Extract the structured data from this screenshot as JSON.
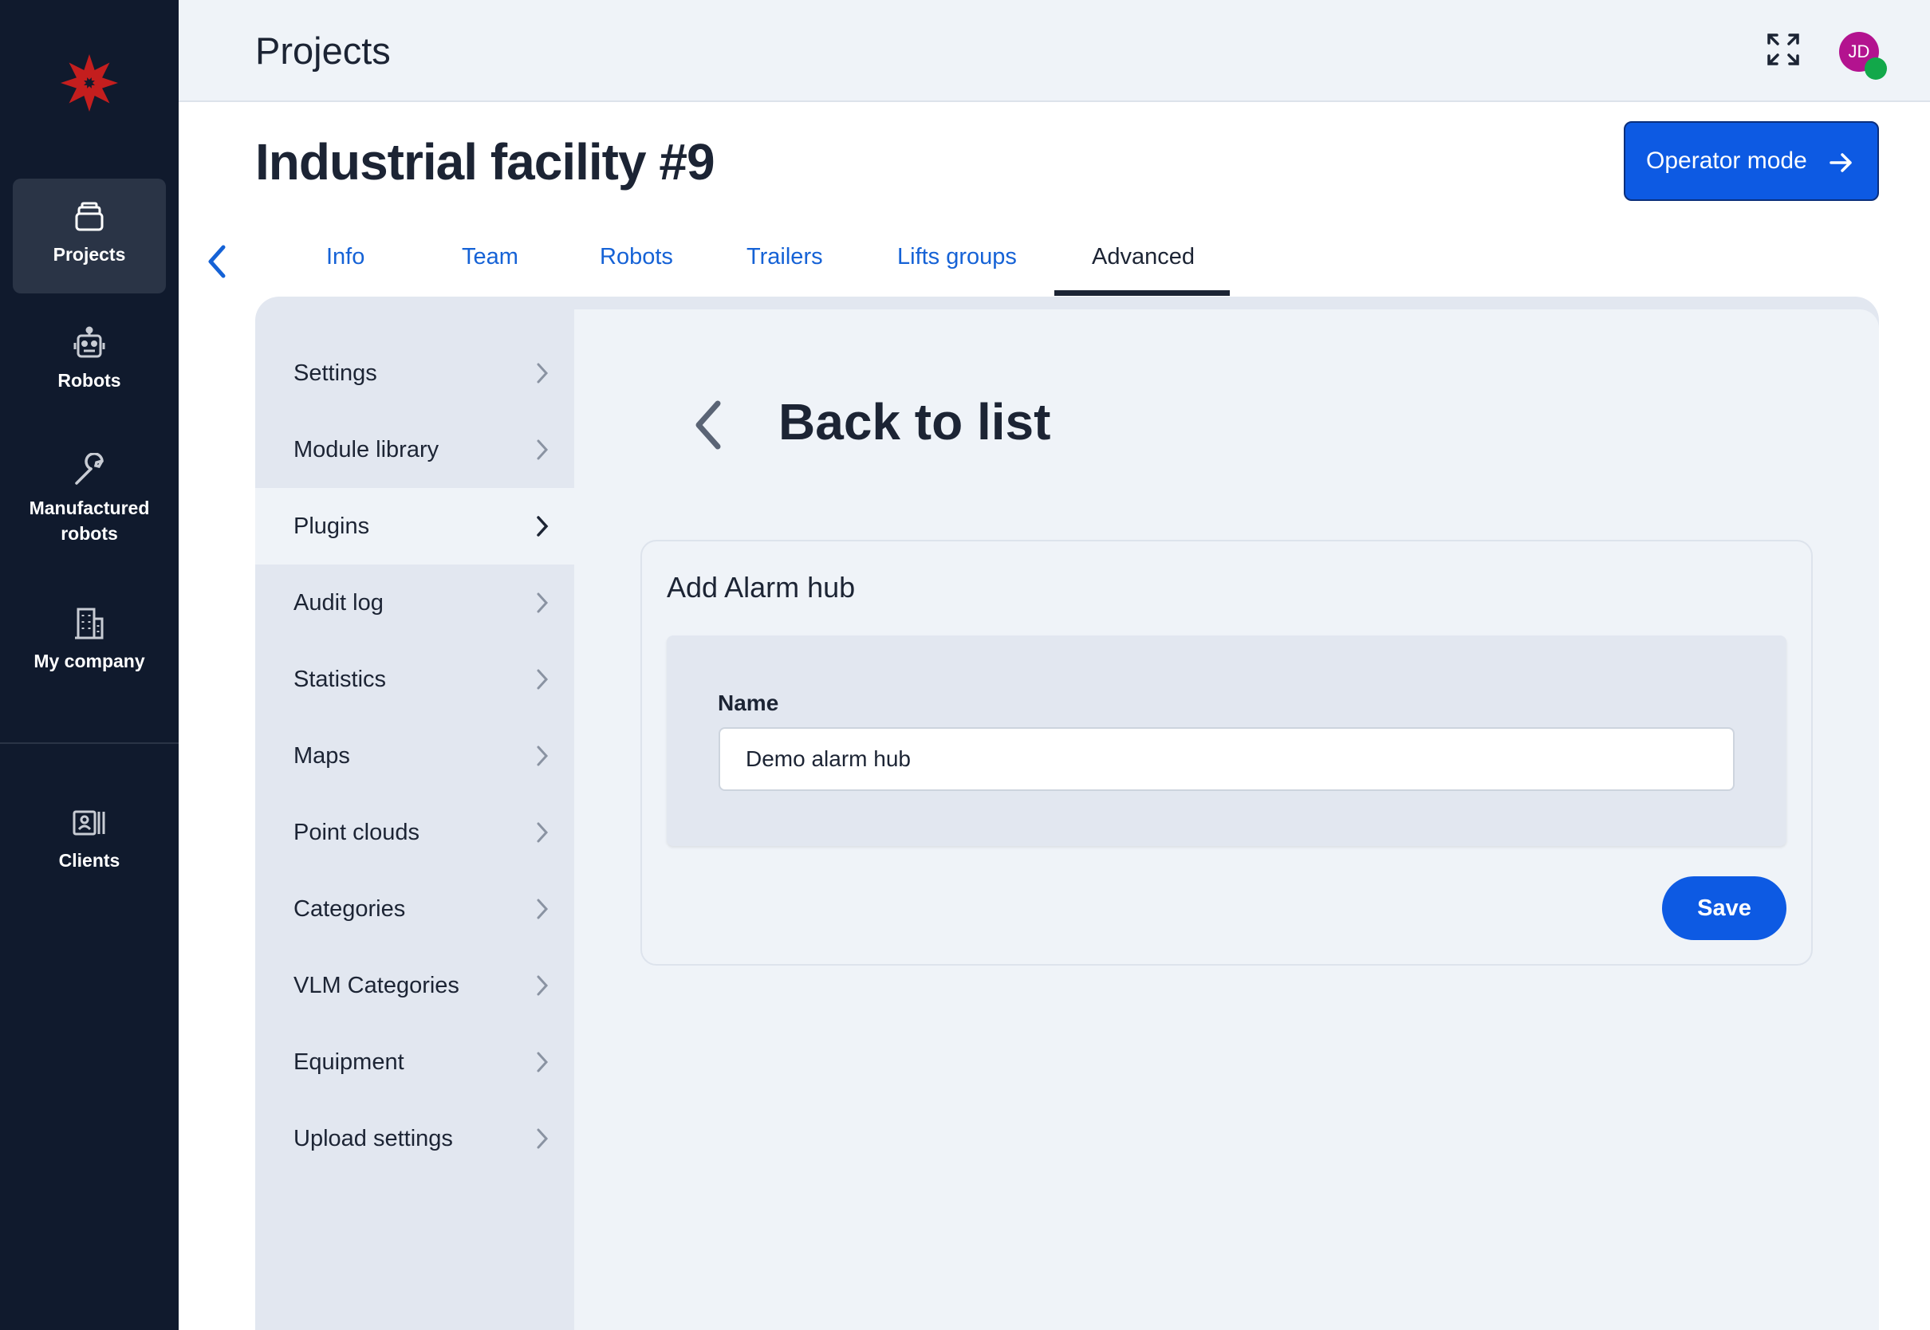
{
  "app": {
    "brand_icon": "snowflake-star-logo",
    "accent_color": "#0d5ae3",
    "nav_bg": "#101a2d"
  },
  "nav": {
    "items": [
      {
        "label": "Projects",
        "icon": "stack-icon",
        "active": true
      },
      {
        "label": "Robots",
        "icon": "robot-icon"
      },
      {
        "label": "Manufactured robots",
        "icon": "wrench-icon"
      },
      {
        "label": "My company",
        "icon": "building-icon"
      },
      {
        "label": "Clients",
        "icon": "id-card-icon"
      }
    ]
  },
  "header": {
    "title": "Projects",
    "avatar_initials": "JD"
  },
  "page": {
    "title": "Industrial facility #9",
    "operator_button": "Operator mode"
  },
  "tabs": [
    {
      "label": "Info"
    },
    {
      "label": "Team"
    },
    {
      "label": "Robots"
    },
    {
      "label": "Trailers"
    },
    {
      "label": "Lifts groups"
    },
    {
      "label": "Advanced",
      "active": true
    }
  ],
  "sidebar": {
    "items": [
      {
        "label": "Settings"
      },
      {
        "label": "Module library"
      },
      {
        "label": "Plugins",
        "active": true
      },
      {
        "label": "Audit log"
      },
      {
        "label": "Statistics"
      },
      {
        "label": "Maps"
      },
      {
        "label": "Point clouds"
      },
      {
        "label": "Categories"
      },
      {
        "label": "VLM Categories"
      },
      {
        "label": "Equipment"
      },
      {
        "label": "Upload settings"
      }
    ]
  },
  "content": {
    "back_label": "Back to list",
    "form": {
      "title": "Add Alarm hub",
      "name_label": "Name",
      "name_value": "Demo alarm hub",
      "save_label": "Save"
    }
  }
}
